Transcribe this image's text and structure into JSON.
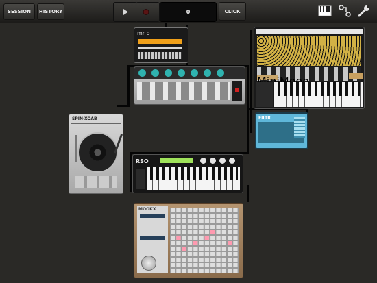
{
  "toolbar": {
    "session_label": "SESSION",
    "history_label": "HISTORY",
    "counter_value": "0",
    "click_label": "CLICK"
  },
  "icons": {
    "play": "play-icon",
    "record": "record-icon",
    "keyboard": "keyboard-icon",
    "routing": "routing-icon",
    "settings": "wrench-icon"
  },
  "devices": {
    "mini": {
      "brand": "mr o"
    },
    "turntable": {
      "title": "SPIN-XOAB"
    },
    "filter": {
      "title": "FILTR"
    },
    "keys": {
      "brand": "RSO"
    },
    "sequencer": {
      "title": "MOOKX"
    },
    "moog": {
      "brand": "MiniMoog"
    }
  },
  "colors": {
    "accent_green": "#9fe35a",
    "orange_display": "#f0a01a",
    "teal_knob": "#2fb3b0",
    "seq_led_on": "#ff9ab0"
  }
}
